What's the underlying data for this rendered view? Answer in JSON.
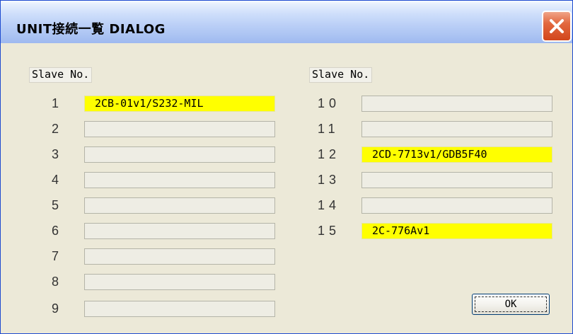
{
  "window": {
    "title": "UNIT接続一覧 DIALOG",
    "close_symbol": "close-icon"
  },
  "left_column": {
    "header": "Slave No.",
    "rows": [
      {
        "number": "1",
        "value": ""
      },
      {
        "number": "2",
        "value": ""
      },
      {
        "number": "3",
        "value": ""
      },
      {
        "number": "4",
        "value": ""
      },
      {
        "number": "5",
        "value": ""
      },
      {
        "number": "6",
        "value": ""
      },
      {
        "number": "7",
        "value": ""
      },
      {
        "number": "8",
        "value": ""
      },
      {
        "number": "9",
        "value": ""
      }
    ]
  },
  "right_column": {
    "header": "Slave No.",
    "rows": [
      {
        "number": "10",
        "value": ""
      },
      {
        "number": "11",
        "value": ""
      },
      {
        "number": "12",
        "value": ""
      },
      {
        "number": "13",
        "value": ""
      },
      {
        "number": "14",
        "value": ""
      },
      {
        "number": "15",
        "value": ""
      }
    ]
  },
  "slaves": {
    "s1": "2CB-01v1/S232-MIL",
    "s12": "2CD-7713v1/GDB5F40",
    "s15": "2C-776Av1"
  },
  "buttons": {
    "ok_label": "OK"
  },
  "colors": {
    "filled_field": "#ffff00",
    "empty_field": "#eeede4",
    "dialog_face": "#ece9d8",
    "close_button": "#d2461c"
  }
}
